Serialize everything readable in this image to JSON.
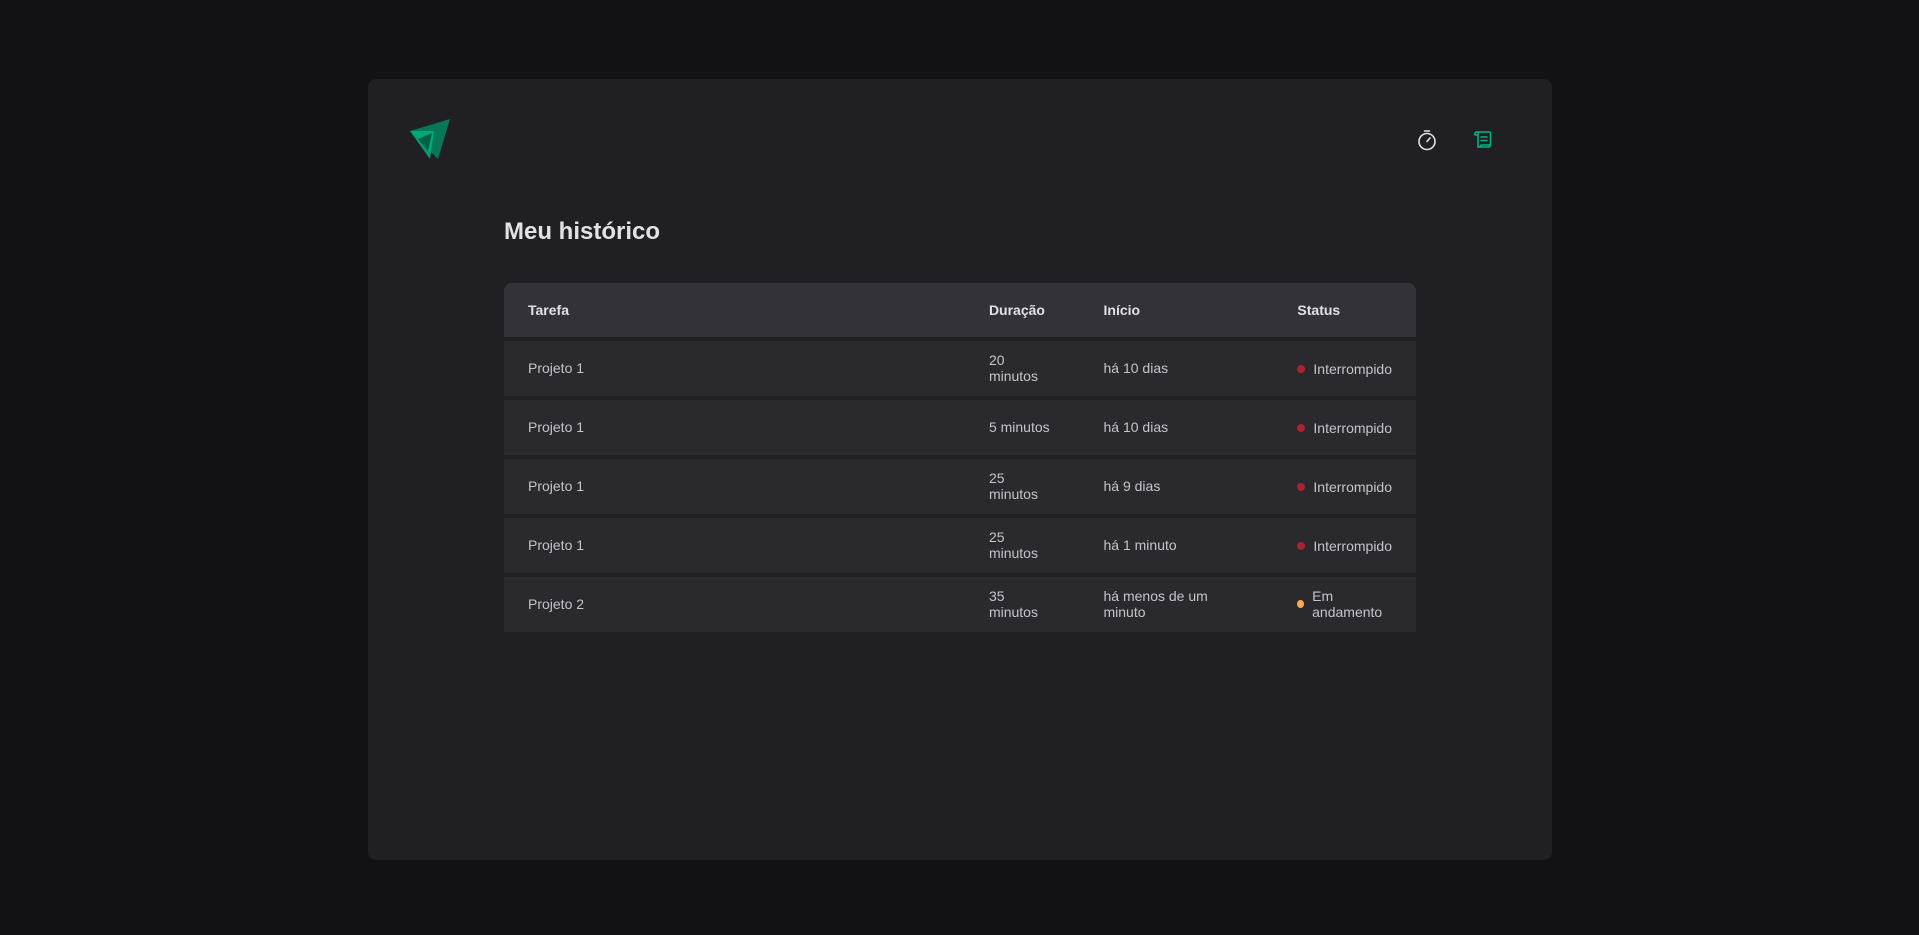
{
  "header": {
    "logo_icon": "triangle-logo-icon",
    "nav": [
      {
        "icon": "timer-icon",
        "active": false
      },
      {
        "icon": "scroll-icon",
        "active": true
      }
    ]
  },
  "history": {
    "title": "Meu histórico",
    "columns": [
      "Tarefa",
      "Duração",
      "Início",
      "Status"
    ],
    "rows": [
      {
        "task": "Projeto 1",
        "duration": "20 minutos",
        "start": "há 10 dias",
        "status": "Interrompido",
        "status_color": "#AB222E"
      },
      {
        "task": "Projeto 1",
        "duration": "5 minutos",
        "start": "há 10 dias",
        "status": "Interrompido",
        "status_color": "#AB222E"
      },
      {
        "task": "Projeto 1",
        "duration": "25 minutos",
        "start": "há 9 dias",
        "status": "Interrompido",
        "status_color": "#AB222E"
      },
      {
        "task": "Projeto 1",
        "duration": "25 minutos",
        "start": "há 1 minuto",
        "status": "Interrompido",
        "status_color": "#AB222E"
      },
      {
        "task": "Projeto 2",
        "duration": "35 minutos",
        "start": "há menos de um minuto",
        "status": "Em andamento",
        "status_color": "#FBA94C"
      }
    ]
  },
  "colors": {
    "accent": "#00B37E",
    "background": "#121214",
    "panel": "#202024",
    "header_row": "#323238",
    "row": "#29292E"
  }
}
